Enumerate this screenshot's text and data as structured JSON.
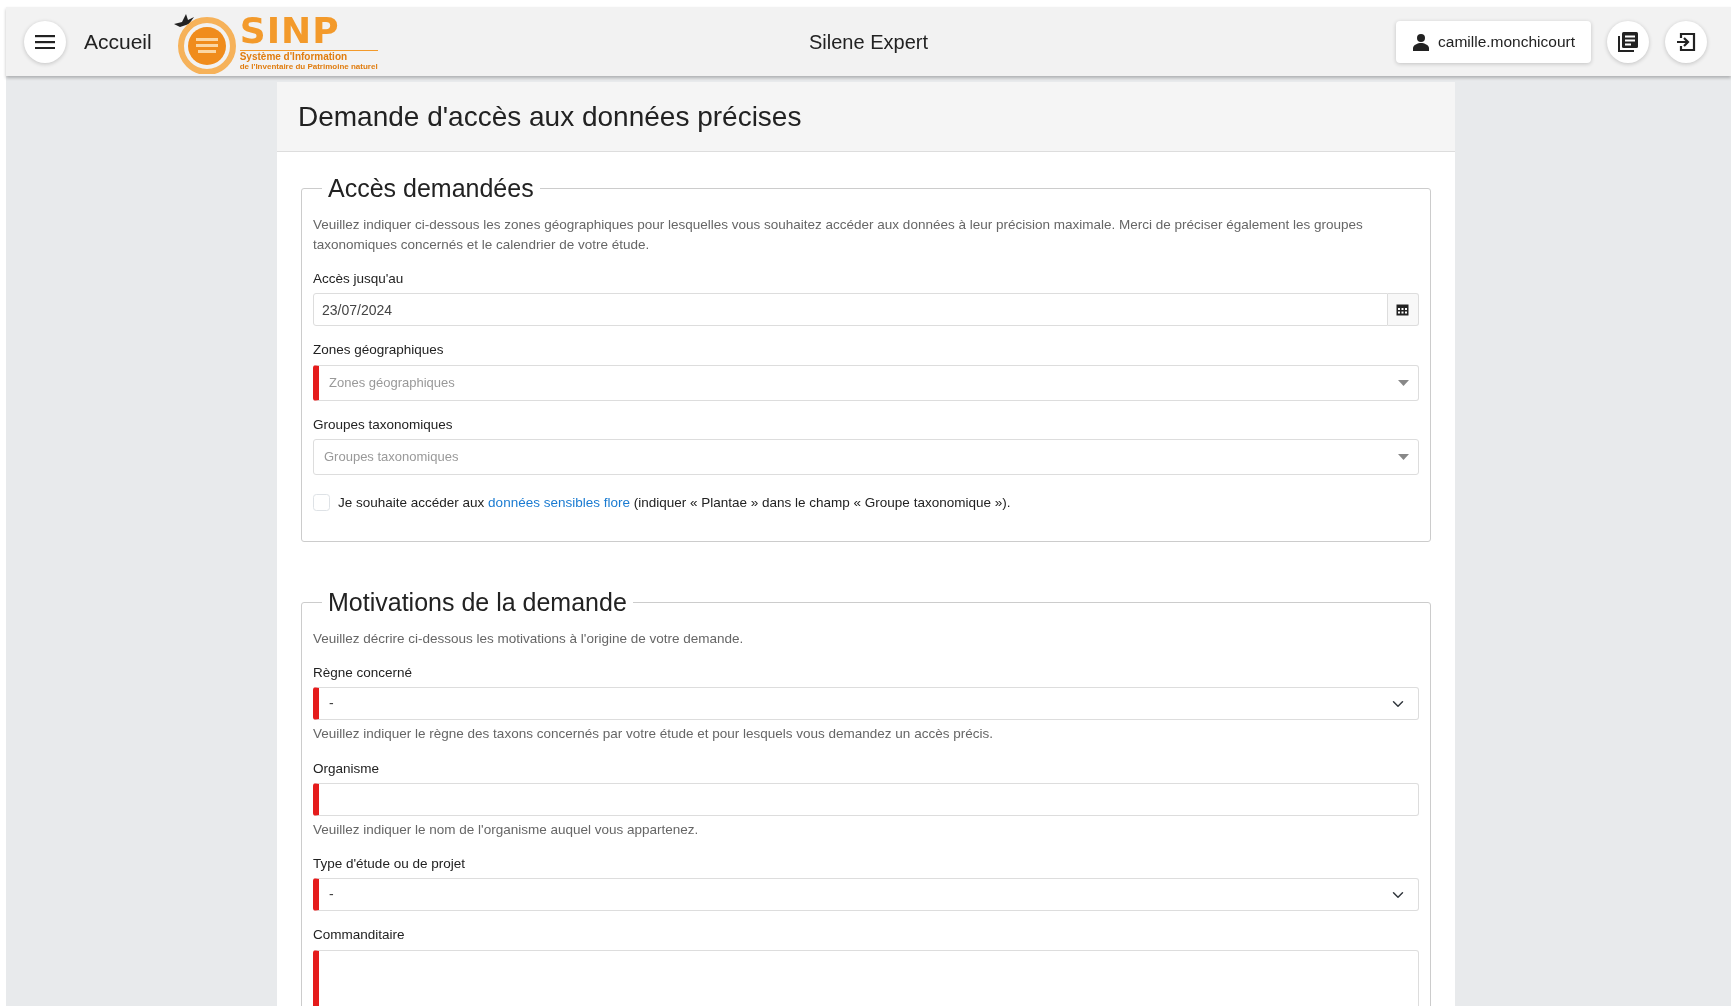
{
  "header": {
    "home_link": "Accueil",
    "logo": {
      "title": "SINP",
      "line_1": "Système d'Information",
      "line_2": "de l'Inventaire du Patrimoine naturel"
    },
    "app_title": "Silene Expert",
    "user": "camille.monchicourt"
  },
  "page_title": "Demande d'accès aux données précises",
  "sections": [
    {
      "legend": "Accès demandées",
      "description": "Veuillez indiquer ci-dessous les zones géographiques pour lesquelles vous souhaitez accéder aux données à leur précision maximale. Merci de préciser également les groupes taxonomiques concernés et le calendrier de votre étude.",
      "fields": [
        {
          "kind": "date",
          "label": "Accès jusqu'au",
          "value": "23/07/2024",
          "required": false
        },
        {
          "kind": "multiselect",
          "label": "Zones géographiques",
          "placeholder": "Zones géographiques",
          "required": true
        },
        {
          "kind": "multiselect",
          "label": "Groupes taxonomiques",
          "placeholder": "Groupes taxonomiques",
          "required": false
        },
        {
          "kind": "checkbox",
          "text_before": "Je souhaite accéder aux",
          "link": "données sensibles flore",
          "text_after": "(indiquer « Plantae » dans le champ « Groupe taxonomique »).",
          "checked": false
        }
      ]
    },
    {
      "legend": "Motivations de la demande",
      "description": "Veuillez décrire ci-dessous les motivations à l'origine de votre demande.",
      "fields": [
        {
          "kind": "select",
          "label": "Règne concerné",
          "value": "-",
          "required": true,
          "help": "Veuillez indiquer le règne des taxons concernés par votre étude et pour lesquels vous demandez un accès précis."
        },
        {
          "kind": "text",
          "label": "Organisme",
          "required": true,
          "help": "Veuillez indiquer le nom de l'organisme auquel vous appartenez."
        },
        {
          "kind": "select",
          "label": "Type d'étude ou de projet",
          "value": "-",
          "required": true
        },
        {
          "kind": "textarea",
          "label": "Commanditaire",
          "required": true
        }
      ]
    }
  ]
}
